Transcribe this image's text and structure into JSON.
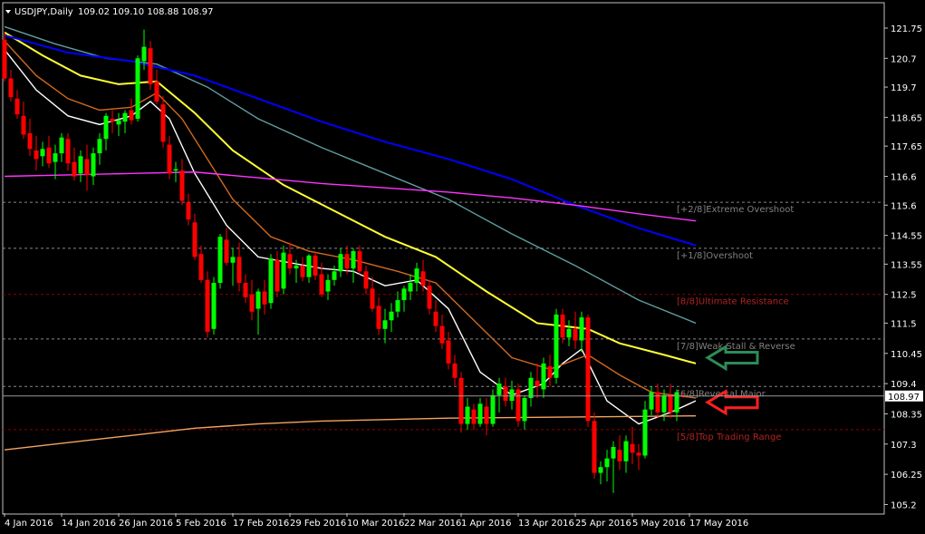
{
  "header": {
    "symbol": "USDJPY,Daily",
    "ohlc": "109.02 109.10 108.88 108.97"
  },
  "chart_data": {
    "type": "candlestick",
    "symbol": "USDJPY",
    "timeframe": "Daily",
    "last_price": 108.97,
    "x_labels": [
      "4 Jan 2016",
      "14 Jan 2016",
      "26 Jan 2016",
      "5 Feb 2016",
      "17 Feb 2016",
      "29 Feb 2016",
      "10 Mar 2016",
      "22 Mar 2016",
      "1 Apr 2016",
      "13 Apr 2016",
      "25 Apr 2016",
      "5 May 2016",
      "17 May 2016"
    ],
    "y_ticks": [
      121.75,
      120.7,
      119.7,
      118.65,
      117.65,
      116.6,
      115.6,
      114.55,
      113.55,
      112.5,
      111.5,
      110.45,
      109.4,
      108.35,
      107.3,
      106.25,
      105.2
    ],
    "ylim": [
      104.9,
      122.6
    ],
    "candles": [
      [
        121.35,
        121.6,
        119.9,
        120.0
      ],
      [
        120.0,
        120.3,
        119.2,
        119.35
      ],
      [
        119.3,
        119.6,
        118.6,
        118.75
      ],
      [
        118.7,
        119.2,
        117.9,
        118.05
      ],
      [
        118.1,
        118.6,
        117.3,
        117.55
      ],
      [
        117.5,
        118.0,
        116.8,
        117.2
      ],
      [
        117.3,
        117.8,
        116.95,
        117.55
      ],
      [
        117.6,
        118.0,
        116.9,
        117.05
      ],
      [
        117.1,
        117.7,
        116.5,
        117.4
      ],
      [
        117.4,
        118.1,
        117.1,
        117.95
      ],
      [
        117.9,
        118.1,
        116.8,
        117.05
      ],
      [
        117.1,
        117.6,
        116.45,
        116.6
      ],
      [
        116.7,
        117.5,
        116.4,
        117.3
      ],
      [
        117.2,
        117.7,
        116.1,
        116.65
      ],
      [
        116.6,
        117.6,
        116.3,
        117.4
      ],
      [
        117.4,
        118.1,
        117.0,
        117.9
      ],
      [
        117.9,
        118.8,
        117.5,
        118.7
      ],
      [
        118.6,
        118.9,
        118.1,
        118.5
      ],
      [
        118.4,
        118.8,
        118.0,
        118.55
      ],
      [
        118.5,
        118.9,
        118.1,
        118.8
      ],
      [
        118.9,
        119.3,
        118.4,
        118.55
      ],
      [
        118.6,
        120.8,
        118.5,
        120.7
      ],
      [
        120.6,
        121.7,
        120.3,
        121.1
      ],
      [
        121.05,
        121.3,
        119.6,
        119.8
      ],
      [
        119.9,
        120.3,
        119.1,
        119.2
      ],
      [
        119.1,
        119.4,
        117.6,
        117.8
      ],
      [
        117.7,
        118.0,
        116.5,
        116.7
      ],
      [
        116.8,
        117.1,
        116.4,
        116.85
      ],
      [
        116.8,
        117.2,
        115.6,
        115.75
      ],
      [
        115.7,
        116.0,
        114.9,
        115.1
      ],
      [
        115.0,
        115.3,
        113.7,
        113.8
      ],
      [
        113.9,
        114.2,
        112.9,
        113.0
      ],
      [
        113.0,
        113.3,
        111.0,
        111.2
      ],
      [
        111.3,
        113.1,
        111.1,
        112.9
      ],
      [
        112.9,
        114.6,
        112.7,
        114.5
      ],
      [
        114.4,
        114.8,
        113.5,
        113.6
      ],
      [
        113.6,
        114.1,
        112.8,
        113.8
      ],
      [
        113.8,
        114.3,
        112.6,
        112.9
      ],
      [
        112.9,
        113.2,
        112.2,
        112.4
      ],
      [
        112.5,
        113.0,
        111.6,
        111.9
      ],
      [
        112.0,
        112.7,
        111.1,
        112.6
      ],
      [
        112.6,
        113.0,
        111.8,
        112.15
      ],
      [
        112.2,
        113.9,
        112.0,
        113.75
      ],
      [
        113.7,
        114.0,
        112.4,
        112.6
      ],
      [
        112.7,
        114.2,
        112.5,
        113.95
      ],
      [
        113.9,
        114.3,
        113.2,
        113.4
      ],
      [
        113.4,
        113.7,
        112.9,
        113.5
      ],
      [
        113.5,
        113.8,
        112.95,
        113.1
      ],
      [
        113.1,
        113.9,
        112.9,
        113.85
      ],
      [
        113.85,
        114.0,
        113.0,
        113.15
      ],
      [
        113.2,
        113.6,
        112.4,
        112.5
      ],
      [
        112.6,
        113.2,
        112.3,
        113.0
      ],
      [
        113.0,
        113.5,
        112.8,
        113.3
      ],
      [
        113.3,
        114.1,
        113.1,
        113.9
      ],
      [
        113.9,
        114.2,
        113.2,
        113.4
      ],
      [
        113.4,
        114.1,
        112.9,
        114.0
      ],
      [
        114.0,
        114.2,
        113.2,
        113.3
      ],
      [
        113.3,
        113.5,
        112.5,
        112.7
      ],
      [
        112.7,
        113.1,
        111.9,
        112.0
      ],
      [
        112.1,
        112.4,
        111.1,
        111.3
      ],
      [
        111.3,
        112.0,
        110.8,
        111.6
      ],
      [
        111.6,
        112.2,
        111.2,
        111.9
      ],
      [
        111.9,
        112.6,
        111.7,
        112.3
      ],
      [
        112.3,
        112.8,
        111.9,
        112.7
      ],
      [
        112.6,
        113.2,
        112.3,
        112.9
      ],
      [
        112.9,
        113.6,
        112.6,
        113.4
      ],
      [
        113.3,
        113.7,
        112.6,
        112.8
      ],
      [
        112.8,
        113.0,
        111.8,
        112.0
      ],
      [
        111.9,
        112.3,
        111.2,
        111.4
      ],
      [
        111.4,
        111.8,
        110.6,
        110.8
      ],
      [
        110.9,
        111.2,
        109.9,
        110.1
      ],
      [
        110.1,
        110.4,
        109.3,
        109.6
      ],
      [
        109.6,
        109.8,
        107.7,
        108.0
      ],
      [
        108.0,
        108.9,
        107.8,
        108.6
      ],
      [
        108.5,
        108.7,
        107.8,
        108.0
      ],
      [
        108.0,
        108.9,
        107.9,
        108.7
      ],
      [
        108.6,
        108.9,
        107.6,
        108.0
      ],
      [
        108.0,
        109.2,
        107.9,
        109.0
      ],
      [
        109.0,
        109.6,
        108.4,
        109.4
      ],
      [
        109.3,
        109.6,
        108.6,
        108.8
      ],
      [
        108.8,
        109.5,
        108.5,
        109.2
      ],
      [
        109.2,
        109.4,
        107.9,
        108.1
      ],
      [
        108.1,
        109.0,
        107.8,
        108.9
      ],
      [
        108.9,
        109.8,
        108.6,
        109.6
      ],
      [
        109.5,
        110.1,
        108.9,
        109.3
      ],
      [
        109.2,
        110.3,
        108.9,
        110.1
      ],
      [
        110.0,
        110.4,
        109.3,
        109.6
      ],
      [
        109.6,
        112.0,
        109.4,
        111.8
      ],
      [
        111.8,
        112.0,
        110.8,
        111.0
      ],
      [
        111.0,
        111.6,
        110.7,
        111.3
      ],
      [
        111.3,
        111.9,
        110.6,
        110.9
      ],
      [
        110.9,
        111.9,
        110.5,
        111.7
      ],
      [
        111.7,
        111.8,
        107.9,
        108.1
      ],
      [
        108.1,
        108.4,
        106.1,
        106.3
      ],
      [
        106.3,
        106.7,
        105.9,
        106.5
      ],
      [
        106.5,
        107.1,
        106.0,
        106.8
      ],
      [
        106.8,
        107.4,
        105.6,
        107.2
      ],
      [
        107.1,
        107.6,
        106.4,
        106.7
      ],
      [
        106.7,
        107.6,
        106.3,
        107.4
      ],
      [
        107.3,
        107.9,
        106.6,
        107.0
      ],
      [
        107.0,
        107.3,
        106.4,
        106.9
      ],
      [
        106.9,
        108.8,
        106.8,
        108.5
      ],
      [
        108.5,
        109.3,
        108.3,
        109.1
      ],
      [
        109.1,
        109.4,
        108.2,
        108.4
      ],
      [
        108.4,
        109.2,
        108.1,
        109.0
      ],
      [
        109.0,
        109.4,
        108.2,
        108.4
      ],
      [
        108.4,
        109.2,
        108.1,
        109.1
      ],
      [
        109.0,
        109.1,
        108.9,
        108.97
      ]
    ],
    "indicators": [
      {
        "color": "#ffffff",
        "values": [
          [
            0,
            121.0
          ],
          [
            5,
            119.6
          ],
          [
            10,
            118.7
          ],
          [
            15,
            118.4
          ],
          [
            20,
            118.7
          ],
          [
            23,
            119.2
          ],
          [
            26,
            118.6
          ],
          [
            30,
            116.7
          ],
          [
            35,
            114.9
          ],
          [
            40,
            113.8
          ],
          [
            45,
            113.6
          ],
          [
            50,
            113.4
          ],
          [
            55,
            113.3
          ],
          [
            60,
            112.8
          ],
          [
            65,
            113.0
          ],
          [
            70,
            112.0
          ],
          [
            75,
            109.8
          ],
          [
            80,
            109.0
          ],
          [
            85,
            109.4
          ],
          [
            88,
            110.1
          ],
          [
            91,
            110.6
          ],
          [
            95,
            108.8
          ],
          [
            100,
            108.0
          ],
          [
            105,
            108.4
          ],
          [
            109,
            108.8
          ]
        ]
      },
      {
        "color": "#d2691e",
        "values": [
          [
            0,
            121.3
          ],
          [
            5,
            120.1
          ],
          [
            10,
            119.3
          ],
          [
            15,
            118.9
          ],
          [
            20,
            119.0
          ],
          [
            24,
            119.5
          ],
          [
            28,
            118.6
          ],
          [
            32,
            117.2
          ],
          [
            36,
            115.8
          ],
          [
            42,
            114.5
          ],
          [
            48,
            114.0
          ],
          [
            55,
            113.7
          ],
          [
            62,
            113.3
          ],
          [
            68,
            112.9
          ],
          [
            74,
            111.6
          ],
          [
            80,
            110.3
          ],
          [
            86,
            109.9
          ],
          [
            92,
            110.4
          ],
          [
            97,
            109.7
          ],
          [
            102,
            109.1
          ],
          [
            109,
            108.9
          ]
        ]
      },
      {
        "color": "#ffff33",
        "values": [
          [
            0,
            121.6
          ],
          [
            6,
            120.8
          ],
          [
            12,
            120.1
          ],
          [
            18,
            119.8
          ],
          [
            24,
            119.9
          ],
          [
            30,
            118.8
          ],
          [
            36,
            117.5
          ],
          [
            44,
            116.3
          ],
          [
            52,
            115.4
          ],
          [
            60,
            114.5
          ],
          [
            68,
            113.8
          ],
          [
            76,
            112.6
          ],
          [
            84,
            111.5
          ],
          [
            92,
            111.3
          ],
          [
            97,
            110.8
          ],
          [
            104,
            110.4
          ],
          [
            109,
            110.1
          ]
        ]
      },
      {
        "color": "#5f9ea0",
        "values": [
          [
            0,
            121.8
          ],
          [
            8,
            121.2
          ],
          [
            16,
            120.7
          ],
          [
            24,
            120.5
          ],
          [
            32,
            119.7
          ],
          [
            40,
            118.6
          ],
          [
            50,
            117.6
          ],
          [
            60,
            116.7
          ],
          [
            70,
            115.8
          ],
          [
            80,
            114.6
          ],
          [
            90,
            113.5
          ],
          [
            100,
            112.3
          ],
          [
            109,
            111.5
          ]
        ]
      },
      {
        "color": "#0000ff",
        "values": [
          [
            0,
            121.5
          ],
          [
            10,
            120.9
          ],
          [
            20,
            120.6
          ],
          [
            30,
            120.1
          ],
          [
            40,
            119.3
          ],
          [
            50,
            118.5
          ],
          [
            60,
            117.8
          ],
          [
            70,
            117.2
          ],
          [
            80,
            116.5
          ],
          [
            90,
            115.6
          ],
          [
            100,
            114.8
          ],
          [
            109,
            114.2
          ]
        ]
      },
      {
        "color": "#ff33ff",
        "values": [
          [
            0,
            116.6
          ],
          [
            10,
            116.65
          ],
          [
            20,
            116.7
          ],
          [
            30,
            116.75
          ],
          [
            40,
            116.55
          ],
          [
            50,
            116.35
          ],
          [
            60,
            116.2
          ],
          [
            70,
            116.05
          ],
          [
            80,
            115.85
          ],
          [
            90,
            115.6
          ],
          [
            100,
            115.3
          ],
          [
            109,
            115.05
          ]
        ]
      },
      {
        "color": "#f4a460",
        "values": [
          [
            0,
            107.1
          ],
          [
            10,
            107.35
          ],
          [
            20,
            107.6
          ],
          [
            30,
            107.85
          ],
          [
            40,
            108.0
          ],
          [
            50,
            108.1
          ],
          [
            60,
            108.15
          ],
          [
            70,
            108.2
          ],
          [
            80,
            108.22
          ],
          [
            90,
            108.24
          ],
          [
            100,
            108.26
          ],
          [
            109,
            108.28
          ]
        ]
      }
    ],
    "levels": [
      {
        "label": "[+2/8]Extreme Overshoot",
        "price": 115.7,
        "line": "#888888",
        "text": "#808080"
      },
      {
        "label": "[+1/8]Overshoot",
        "price": 114.1,
        "line": "#888888",
        "text": "#808080"
      },
      {
        "label": "[8/8]Ultimate Resistance",
        "price": 112.5,
        "line": "#8b0000",
        "text": "#b22222"
      },
      {
        "label": "[7/8]Weak Stall & Reverse",
        "price": 110.95,
        "line": "#888888",
        "text": "#808080"
      },
      {
        "label": "[6/8]Reversal Major",
        "price": 109.3,
        "line": "#888888",
        "text": "#808080"
      },
      {
        "label": "[5/8]Top Trading Range",
        "price": 107.8,
        "line": "#8b0000",
        "text": "#b22222"
      }
    ],
    "arrows": [
      {
        "direction": "left",
        "price": 110.3,
        "color": "#2e8b57"
      },
      {
        "direction": "left",
        "price": 108.75,
        "color": "#ff2020"
      }
    ],
    "up_color": "#00ff00",
    "down_color": "#ff0000",
    "background": "#000000"
  }
}
